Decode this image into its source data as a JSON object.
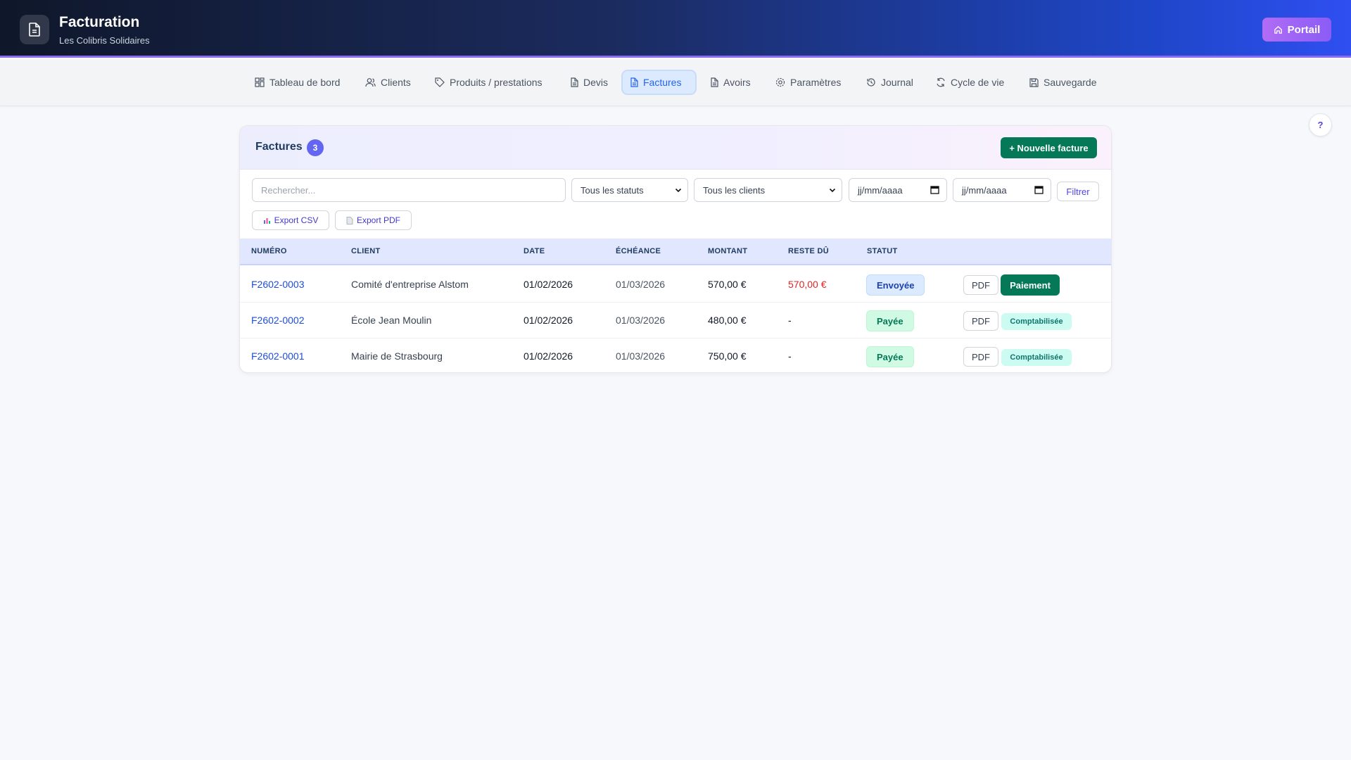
{
  "app": {
    "title": "Facturation",
    "subtitle": "Les Colibris Solidaires",
    "portal_label": "Portail",
    "help_label": "?"
  },
  "nav": {
    "items": [
      {
        "label": "Tableau de bord",
        "icon": "dashboard-icon"
      },
      {
        "label": "Clients",
        "icon": "users-icon"
      },
      {
        "label": "Produits / prestations",
        "icon": "tag-icon"
      },
      {
        "label": "Devis",
        "icon": "document-icon"
      },
      {
        "label": "Factures",
        "icon": "invoice-icon",
        "active": true
      },
      {
        "label": "Avoirs",
        "icon": "document-icon"
      },
      {
        "label": "Paramètres",
        "icon": "gear-icon"
      },
      {
        "label": "Journal",
        "icon": "history-icon"
      },
      {
        "label": "Cycle de vie",
        "icon": "refresh-icon"
      },
      {
        "label": "Sauvegarde",
        "icon": "save-icon"
      }
    ]
  },
  "invoices": {
    "title": "Factures",
    "count": "3",
    "new_button": "+ Nouvelle facture",
    "filters": {
      "search_placeholder": "Rechercher...",
      "status_value": "Tous les statuts",
      "client_value": "Tous les clients",
      "date_from": "jj/mm/aaaa",
      "date_to": "jj/mm/aaaa",
      "filter_button": "Filtrer",
      "export_csv": "Export CSV",
      "export_pdf": "Export PDF"
    },
    "columns": [
      "NUMÉRO",
      "CLIENT",
      "DATE",
      "ÉCHÉANCE",
      "MONTANT",
      "RESTE DÛ",
      "STATUT"
    ],
    "rows": [
      {
        "number": "F2602-0003",
        "client": "Comité d'entreprise Alstom",
        "date": "01/02/2026",
        "due": "01/03/2026",
        "amount": "570,00 €",
        "remaining": "570,00 €",
        "status": "Envoyée",
        "pdf": "PDF",
        "action": "Paiement"
      },
      {
        "number": "F2602-0002",
        "client": "École Jean Moulin",
        "date": "01/02/2026",
        "due": "01/03/2026",
        "amount": "480,00 €",
        "remaining": "-",
        "status": "Payée",
        "pdf": "PDF",
        "action": "Comptabilisée"
      },
      {
        "number": "F2602-0001",
        "client": "Mairie de Strasbourg",
        "date": "01/02/2026",
        "due": "01/03/2026",
        "amount": "750,00 €",
        "remaining": "-",
        "status": "Payée",
        "pdf": "PDF",
        "action": "Comptabilisée"
      }
    ]
  },
  "colors": {
    "accent": "#2563eb",
    "primary_green": "#047857",
    "due_red": "#dc2626",
    "badge": "#6366f1"
  }
}
